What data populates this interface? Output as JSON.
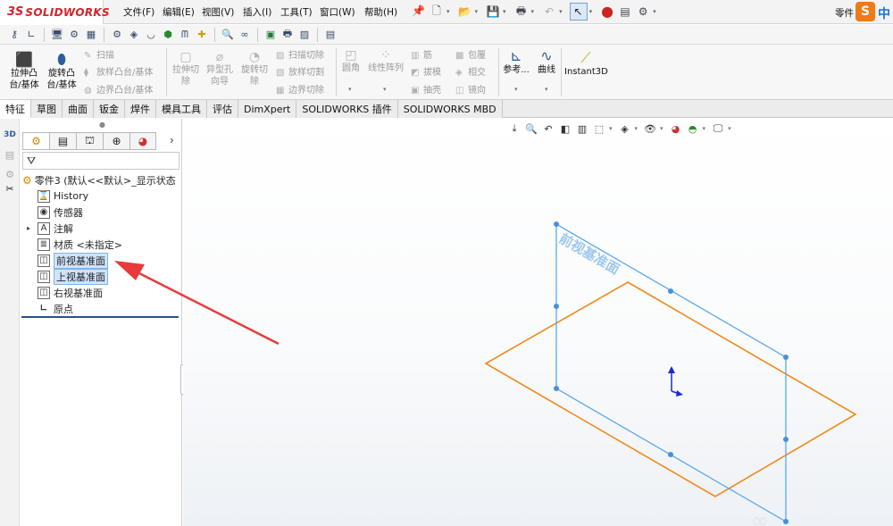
{
  "app": {
    "brand_prefix": "3S",
    "brand_name": "SOLIDWORKS"
  },
  "menu": [
    "文件(F)",
    "编辑(E)",
    "视图(V)",
    "插入(I)",
    "工具(T)",
    "窗口(W)",
    "帮助(H)"
  ],
  "title_right": {
    "part_name": "零件",
    "ime_label": "中"
  },
  "ribbon": {
    "extrude_boss": "拉伸凸\n台/基体",
    "revolve_boss": "旋转凸\n台/基体",
    "sweep": "扫描",
    "loft_boss": "放样凸台/基体",
    "boundary_boss": "边界凸台/基体",
    "extrude_cut": "拉伸切\n除",
    "hole_wizard": "异型孔\n向导",
    "revolve_cut": "旋转切\n除",
    "swept_cut": "扫描切除",
    "lofted_cut": "放样切割",
    "boundary_cut": "边界切除",
    "fillet": "圆角",
    "linear_pattern": "线性阵列",
    "rib": "筋",
    "draft": "拔模",
    "shell": "抽壳",
    "wrap": "包覆",
    "intersect": "相交",
    "mirror": "镜向",
    "reference": "参考...",
    "curves": "曲线",
    "instant3d": "Instant3D"
  },
  "tabs": [
    {
      "label": "特征",
      "active": true
    },
    {
      "label": "草图",
      "active": false
    },
    {
      "label": "曲面",
      "active": false
    },
    {
      "label": "钣金",
      "active": false
    },
    {
      "label": "焊件",
      "active": false
    },
    {
      "label": "模具工具",
      "active": false
    },
    {
      "label": "评估",
      "active": false
    },
    {
      "label": "DimXpert",
      "active": false
    },
    {
      "label": "SOLIDWORKS 插件",
      "active": false
    },
    {
      "label": "SOLIDWORKS MBD",
      "active": false
    }
  ],
  "tree": {
    "root": "零件3 (默认<<默认>_显示状态",
    "items": [
      {
        "label": "History",
        "icon": "history-icon"
      },
      {
        "label": "传感器",
        "icon": "sensor-icon"
      },
      {
        "label": "注解",
        "icon": "annotation-icon",
        "expandable": true
      },
      {
        "label": "材质 <未指定>",
        "icon": "material-icon"
      },
      {
        "label": "前视基准面",
        "icon": "plane-icon",
        "selected": true
      },
      {
        "label": "上视基准面",
        "icon": "plane-icon",
        "selected": true
      },
      {
        "label": "右视基准面",
        "icon": "plane-icon"
      },
      {
        "label": "原点",
        "icon": "origin-icon"
      }
    ]
  },
  "viewport": {
    "plane_label": "前视基准面"
  },
  "colors": {
    "front_plane": "#5aa8ec",
    "top_plane": "#f08a1c",
    "arrow": "#e83a3a",
    "origin": "#1a2ad8",
    "brand": "#d2232a"
  }
}
